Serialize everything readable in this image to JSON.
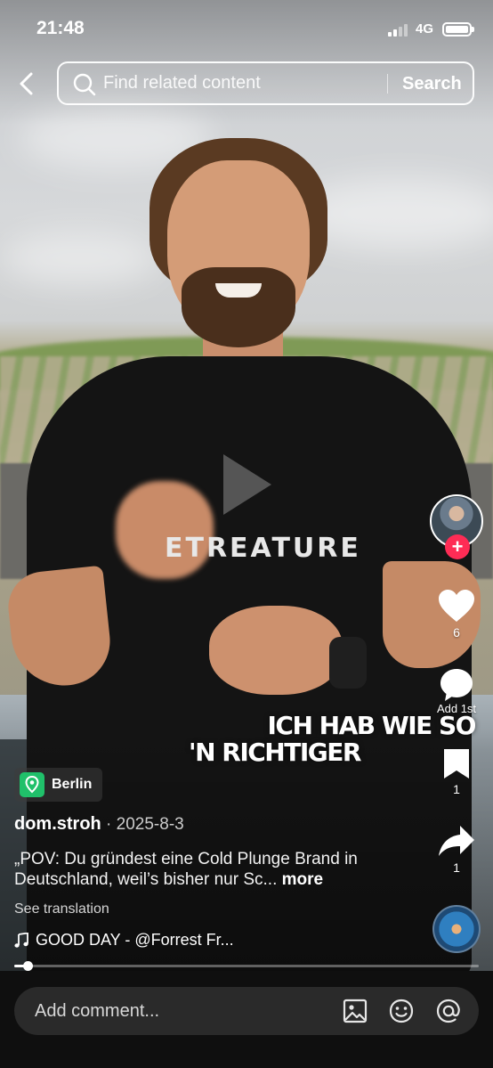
{
  "status_bar": {
    "time": "21:48",
    "network": "4G"
  },
  "search": {
    "placeholder": "Find related content",
    "button_label": "Search"
  },
  "video": {
    "brand_text": "ETREATURE",
    "caption_line1": "ICH HAB WIE SO",
    "caption_line2": "'N RICHTIGER",
    "progress_fraction": 0.03
  },
  "actions": {
    "like_count": "6",
    "comment_label": "Add 1st",
    "save_count": "1",
    "share_count": "1"
  },
  "post": {
    "location": "Berlin",
    "author": "dom.stroh",
    "date": " · 2025-8-3",
    "description": "„POV: Du gründest eine Cold Plunge Brand in Deutschland, weil’s bisher nur Sc...",
    "more_label": "more",
    "translate_label": "See translation",
    "music": "GOOD DAY - @Forrest Fr..."
  },
  "comment_bar": {
    "placeholder": "Add comment..."
  },
  "icons": [
    "back-icon",
    "search-icon",
    "play-icon",
    "heart-icon",
    "comment-icon",
    "bookmark-icon",
    "share-icon",
    "music-note-icon",
    "location-icon",
    "image-icon",
    "emoji-icon",
    "mention-icon"
  ],
  "colors": {
    "follow_plus": "#fe2c55",
    "location_badge": "#20c06a",
    "bottom_bar": "#0f0f0f"
  }
}
